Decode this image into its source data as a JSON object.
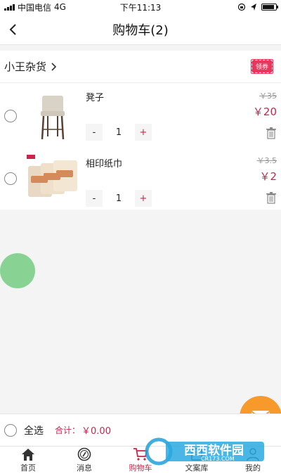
{
  "status_bar": {
    "carrier": "中国电信",
    "network": "4G",
    "time": "下午11:13"
  },
  "nav": {
    "title": "购物车(2)"
  },
  "shop": {
    "name": "小王杂货",
    "coupon_label": "领券"
  },
  "items": [
    {
      "name": "凳子",
      "old_price": "￥35",
      "price": "￥20",
      "quantity": "1",
      "minus": "-",
      "plus": "+"
    },
    {
      "name": "相印纸巾",
      "old_price": "￥3.5",
      "price": "￥2",
      "quantity": "1",
      "minus": "-",
      "plus": "+"
    }
  ],
  "footer": {
    "select_all": "全选",
    "total_label": "合计：",
    "total_value": "￥0.00"
  },
  "tabs": [
    {
      "label": "首页",
      "icon": "home-icon"
    },
    {
      "label": "消息",
      "icon": "compass-icon"
    },
    {
      "label": "购物车",
      "icon": "cart-icon",
      "active": true
    },
    {
      "label": "文案库",
      "icon": "library-icon"
    },
    {
      "label": "我的",
      "icon": "profile-icon"
    }
  ],
  "watermark": {
    "text": "西西软件园",
    "sub": "CR173.COM"
  },
  "colors": {
    "accent": "#c8264a",
    "coupon": "#e8365d",
    "float_orange": "#f79a2b",
    "float_green": "#7ccf8a"
  }
}
